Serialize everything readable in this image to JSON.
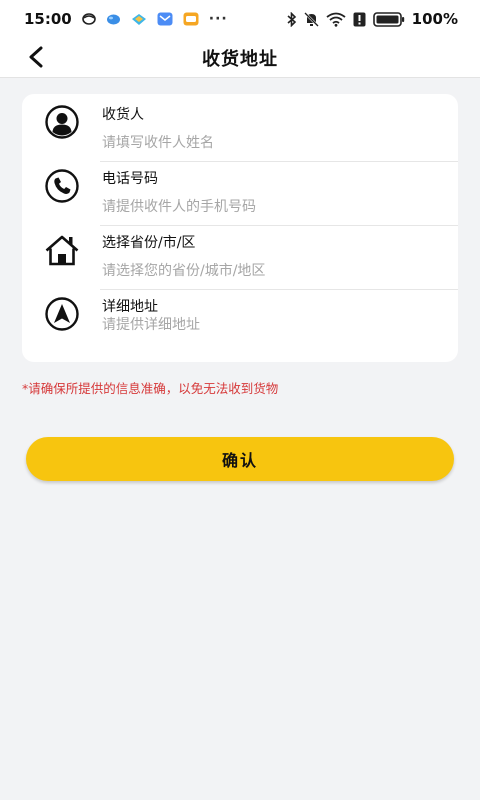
{
  "status_bar": {
    "time": "15:00",
    "more": "···",
    "battery": "100%",
    "icons": [
      "circle-icon",
      "bubble-icon",
      "diamond-icon",
      "mail-icon",
      "message-icon",
      "bluetooth-icon",
      "mute-icon",
      "wifi-icon",
      "alert-icon",
      "battery-icon"
    ]
  },
  "nav": {
    "title": "收货地址",
    "back_icon": "chevron-left-icon"
  },
  "form": {
    "receiver": {
      "label": "收货人",
      "placeholder": "请填写收件人姓名",
      "value": "",
      "icon": "person-icon"
    },
    "phone": {
      "label": "电话号码",
      "placeholder": "请提供收件人的手机号码",
      "value": "",
      "icon": "phone-icon"
    },
    "region": {
      "label": "选择省份/市/区",
      "placeholder": "请选择您的省份/城市/地区",
      "value": "",
      "icon": "home-icon"
    },
    "address": {
      "label": "详细地址",
      "placeholder": "请提供详细地址",
      "value": "",
      "icon": "navigation-icon"
    }
  },
  "tip": "*请确保所提供的信息准确，以免无法收到货物",
  "confirm_label": "确认",
  "colors": {
    "accent": "#f7c50f",
    "tip": "#d6393a",
    "background": "#f2f3f5"
  }
}
